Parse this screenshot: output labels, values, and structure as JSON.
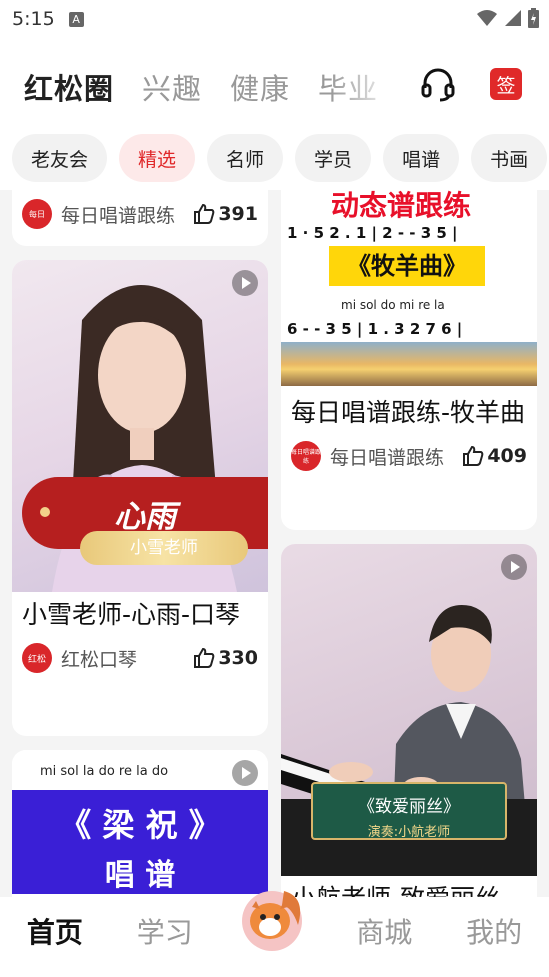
{
  "status": {
    "time": "5:15"
  },
  "header": {
    "tabs": [
      "红松圈",
      "兴趣",
      "健康",
      "毕业"
    ],
    "sign_label": "签"
  },
  "chips": [
    "老友会",
    "精选",
    "名师",
    "学员",
    "唱谱",
    "书画"
  ],
  "cards": {
    "c1": {
      "author": "每日唱谱跟练",
      "likes": "391"
    },
    "c2": {
      "overlay_title": "心雨",
      "overlay_sub": "小雪老师",
      "title": "小雪老师-心雨-口琴",
      "author": "红松口琴",
      "avatar_label": "红松",
      "likes": "330"
    },
    "c3": {
      "banner": "动态谱跟练",
      "song_banner": "《牧羊曲》",
      "score_top": "1 · 5 2 . 1 | 2 - - 3 5 |",
      "score_bottom": "6 - - 3 5 | 1 . 3 2 7 6 |",
      "solfege": "mi  sol  do   mi re la",
      "title": "每日唱谱跟练-牧羊曲",
      "author": "每日唱谱跟练",
      "avatar_label": "每日唱谱跟练",
      "likes": "409"
    },
    "c4": {
      "score_line": "mi  sol  la  do  re  la do",
      "banner_line1": "《 梁  祝 》",
      "banner_line2": "唱  谱"
    },
    "c5": {
      "plaque_title": "《致爱丽丝》",
      "plaque_sub": "演奏:小航老师",
      "title_partial": "小航老师-致爱丽丝"
    }
  },
  "bottom_nav": [
    "首页",
    "学习",
    "商城",
    "我的"
  ],
  "colors": {
    "brand_red": "#e0282a",
    "chip_active_bg": "#fde9e9"
  }
}
